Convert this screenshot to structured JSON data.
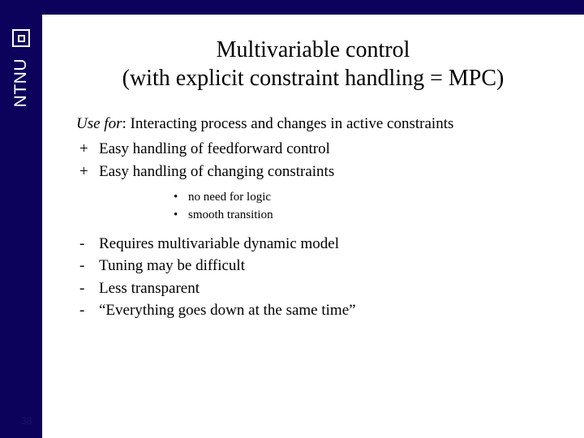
{
  "brand": "NTNU",
  "slide_number": "38",
  "title": {
    "line1": "Multivariable control",
    "line2": "(with explicit constraint handling = MPC)"
  },
  "usefor": {
    "label": "Use for",
    "text": ": Interacting process and changes in active constraints"
  },
  "pros": [
    "Easy handling of feedforward control",
    "Easy handling of changing constraints"
  ],
  "sub": [
    "no need for logic",
    "smooth transition"
  ],
  "cons": [
    "Requires multivariable dynamic model",
    "Tuning may be difficult",
    "Less transparent",
    "“Everything goes down at the same time”"
  ]
}
